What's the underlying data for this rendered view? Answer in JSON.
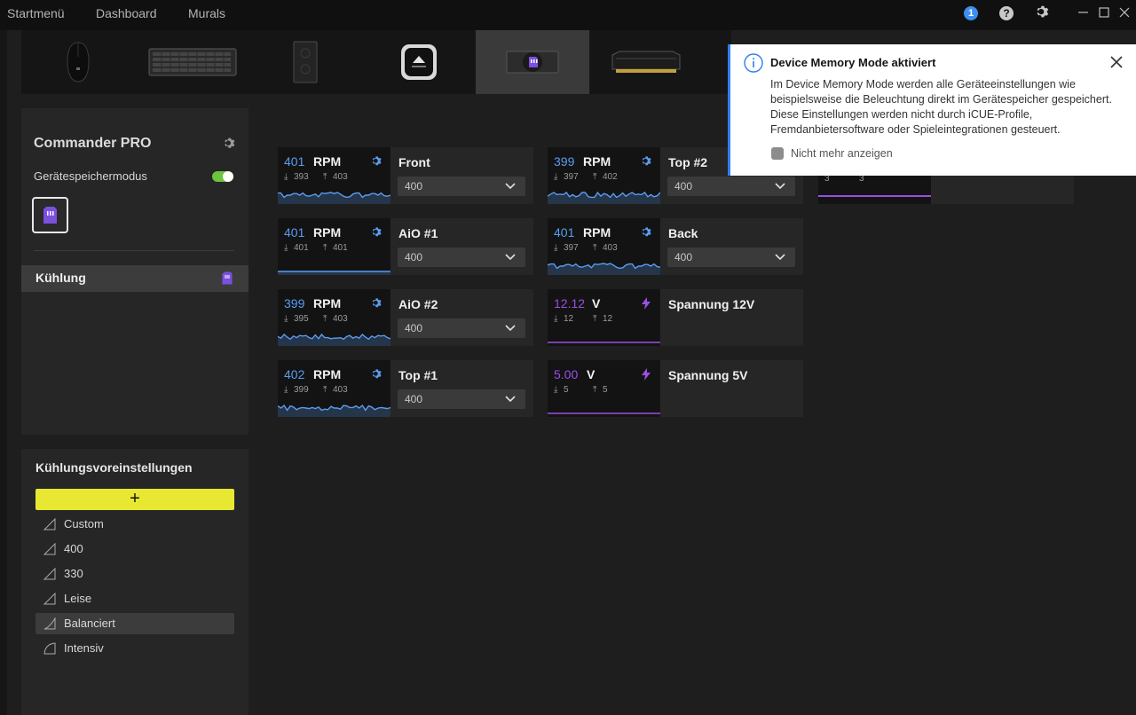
{
  "nav": {
    "items": [
      {
        "label": "Startmenü"
      },
      {
        "label": "Dashboard"
      },
      {
        "label": "Murals"
      }
    ],
    "notification_count": "1",
    "help_label": "?"
  },
  "devices": [
    {
      "name": "mouse-icon"
    },
    {
      "name": "keyboard-icon"
    },
    {
      "name": "case-icon"
    },
    {
      "name": "aio-pump-icon"
    },
    {
      "name": "commander-pro-icon",
      "selected": true
    },
    {
      "name": "ram-icon"
    }
  ],
  "device_panel": {
    "title": "Commander PRO",
    "memory_mode_label": "Gerätespeichermodus",
    "memory_mode_on": true,
    "category": "Kühlung"
  },
  "presets": {
    "title": "Kühlungsvoreinstellungen",
    "add_label": "+",
    "items": [
      {
        "label": "Custom"
      },
      {
        "label": "400"
      },
      {
        "label": "330"
      },
      {
        "label": "Leise"
      },
      {
        "label": "Balanciert",
        "selected": true
      },
      {
        "label": "Intensiv"
      }
    ]
  },
  "tiles": [
    {
      "value": "401",
      "unit": "RPM",
      "min": "393",
      "max": "403",
      "name": "Front",
      "preset": "400",
      "type": "fan"
    },
    {
      "value": "401",
      "unit": "RPM",
      "min": "401",
      "max": "401",
      "name": "AiO #1",
      "preset": "400",
      "type": "fan"
    },
    {
      "value": "399",
      "unit": "RPM",
      "min": "395",
      "max": "403",
      "name": "AiO #2",
      "preset": "400",
      "type": "fan"
    },
    {
      "value": "402",
      "unit": "RPM",
      "min": "399",
      "max": "403",
      "name": "Top #1",
      "preset": "400",
      "type": "fan"
    },
    {
      "value": "399",
      "unit": "RPM",
      "min": "397",
      "max": "402",
      "name": "Top #2",
      "preset": "400",
      "type": "fan"
    },
    {
      "value": "401",
      "unit": "RPM",
      "min": "397",
      "max": "403",
      "name": "Back",
      "preset": "400",
      "type": "fan"
    },
    {
      "value": "12.12",
      "unit": "V",
      "min": "12",
      "max": "12",
      "name": "Spannung 12V",
      "type": "voltage"
    },
    {
      "value": "5.00",
      "unit": "V",
      "min": "5",
      "max": "5",
      "name": "Spannung 5V",
      "type": "voltage"
    }
  ],
  "partial_tile": {
    "min": "3",
    "max": "3"
  },
  "colors": {
    "fan_accent": "#5a9cf0",
    "voltage_accent": "#9a4fe6",
    "toggle_on": "#6ec33f",
    "add_button": "#e8e833"
  },
  "notification": {
    "title": "Device Memory Mode aktiviert",
    "body": "Im Device Memory Mode werden alle Geräteeinstellungen wie beispielsweise die Beleuchtung direkt im Gerätespeicher gespeichert. Diese Einstellungen werden nicht durch iCUE-Profile, Fremdanbietersoftware oder Spieleintegrationen gesteuert.",
    "checkbox_label": "Nicht mehr anzeigen"
  }
}
